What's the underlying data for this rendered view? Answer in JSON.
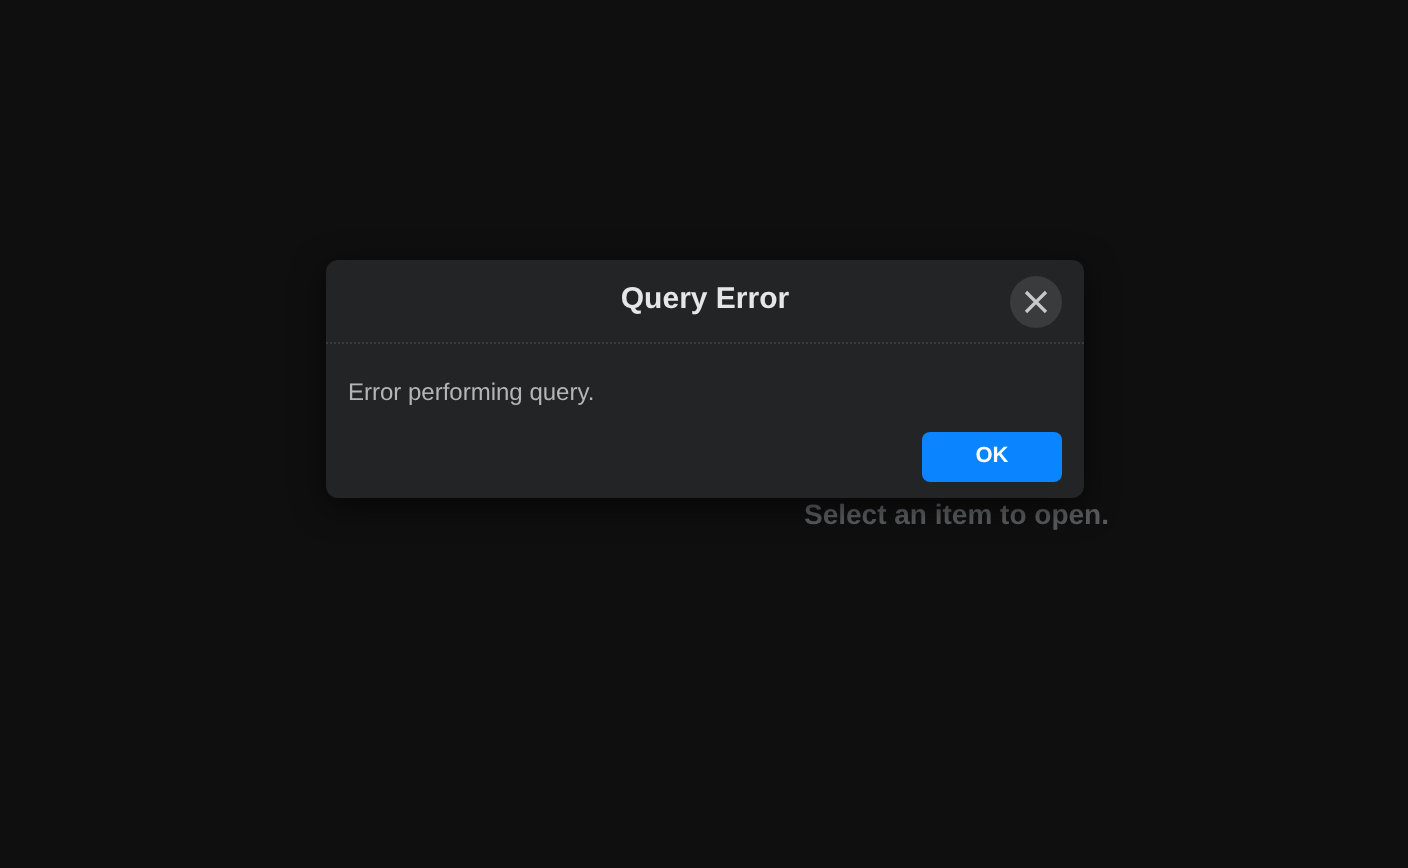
{
  "background": {
    "message": "Select an item to open."
  },
  "dialog": {
    "title": "Query Error",
    "message": "Error performing query.",
    "buttons": [
      "OK"
    ]
  }
}
